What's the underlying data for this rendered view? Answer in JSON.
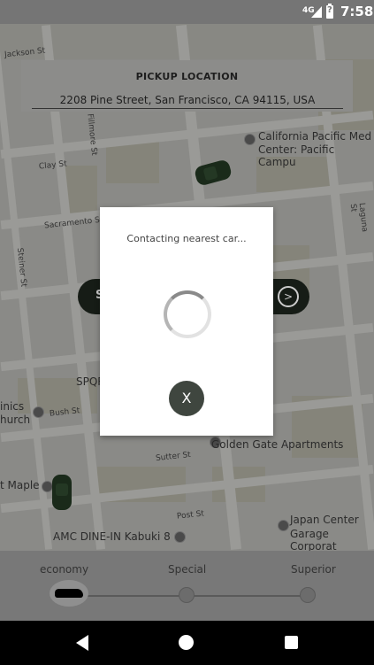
{
  "status": {
    "network": "4G",
    "battery_glyph": "?",
    "time": "7:58"
  },
  "pickup": {
    "title": "PICKUP LOCATION",
    "address": "2208 Pine Street, San Francisco, CA 94115, USA"
  },
  "map": {
    "streets": [
      "Jackson St",
      "Clay St",
      "Sacramento St",
      "Bush St",
      "Sutter St",
      "Post St",
      "Laguna St",
      "Fillmore St",
      "Steiner St"
    ],
    "pois": [
      "California Pacific Med",
      "Center: Pacific Campu",
      "SPQR",
      "inics",
      "hurch",
      "Golden Gate Apartments",
      "t Maple",
      "AMC DINE-IN Kabuki 8",
      "Japan Center",
      "Garage Corporat"
    ],
    "partial_button_letter": "S"
  },
  "dialog": {
    "message": "Contacting nearest car...",
    "cancel_label": "X"
  },
  "selector": {
    "tiers": [
      "economy",
      "Special",
      "Superior"
    ]
  },
  "colors": {
    "dialog_bg": "#ffffff",
    "cancel_button": "#3f463f",
    "overlay_tint": "#7c7c79"
  },
  "icons": [
    "back-icon",
    "home-icon",
    "recents-icon",
    "spinner-icon",
    "go-arrow-icon"
  ]
}
